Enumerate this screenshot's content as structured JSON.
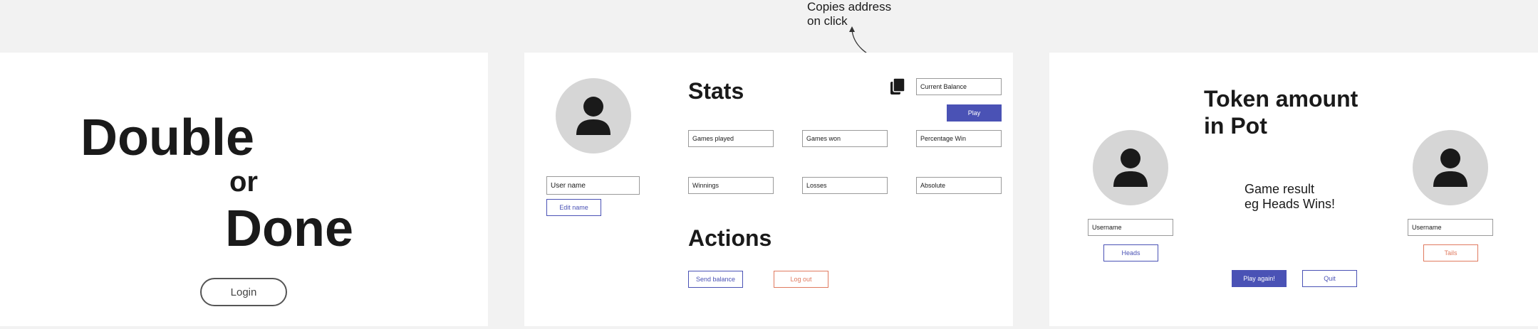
{
  "annotation": {
    "line1": "Copies address",
    "line2": "on click"
  },
  "login_screen": {
    "title_double": "Double",
    "title_or": "or",
    "title_done": "Done",
    "login_label": "Login"
  },
  "profile_screen": {
    "username_field": "User name",
    "edit_name_label": "Edit name",
    "stats_heading": "Stats",
    "actions_heading": "Actions",
    "current_balance": "Current Balance",
    "play_label": "Play",
    "games_played": "Games played",
    "games_won": "Games won",
    "percentage_win": "Percentage Win",
    "winnings": "Winnings",
    "losses": "Losses",
    "absolute": "Absolute",
    "send_balance_label": "Send balance",
    "logout_label": "Log out",
    "copy_icon": "copy-icon"
  },
  "game_screen": {
    "pot_line1": "Token amount",
    "pot_line2": "in Pot",
    "result_line1": "Game result",
    "result_line2": "eg Heads Wins!",
    "left_username": "Username",
    "right_username": "Username",
    "heads_label": "Heads",
    "tails_label": "Tails",
    "play_again_label": "Play again!",
    "quit_label": "Quit"
  },
  "colors": {
    "background": "#f2f2f2",
    "panel": "#ffffff",
    "primary": "#4a52b5",
    "danger_outline": "#e07a5f",
    "avatar_bg": "#d6d6d6",
    "text": "#1a1a1a"
  }
}
